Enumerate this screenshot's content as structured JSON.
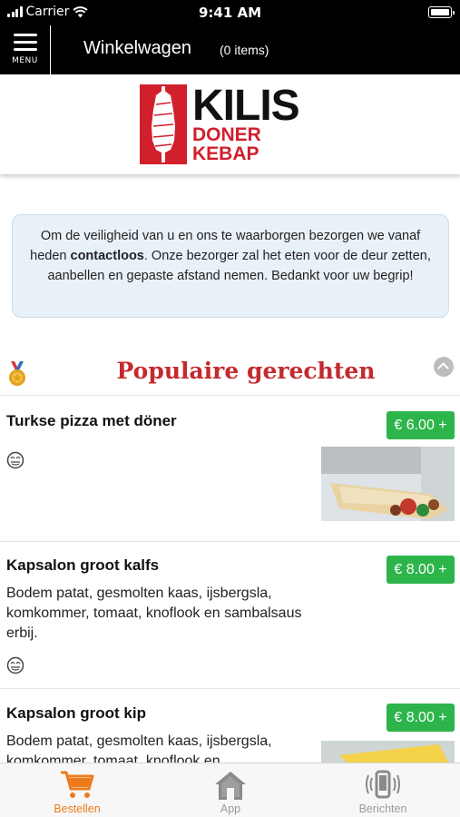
{
  "status_bar": {
    "carrier": "Carrier",
    "time": "9:41 AM"
  },
  "header": {
    "menu_label": "MENU",
    "title": "Winkelwagen",
    "item_count": "(0 items)"
  },
  "logo": {
    "line1": "KILIS",
    "line2": "DONER",
    "line3": "KEBAP"
  },
  "notice": {
    "text_before": "Om de veiligheid van u en ons te waarborgen bezorgen we vanaf heden ",
    "text_bold": "contactloos",
    "text_after": ". Onze bezorger zal het eten voor de deur zetten, aanbellen en gepaste afstand nemen. Bedankt voor uw begrip!"
  },
  "section": {
    "title": "Populaire gerechten"
  },
  "items": [
    {
      "name": "Turkse pizza met döner",
      "price": "€ 6.00 +",
      "description": ""
    },
    {
      "name": "Kapsalon groot kalfs",
      "price": "€ 8.00 +",
      "description": "Bodem patat, gesmolten kaas, ijsbergsla, komkommer, tomaat, knoflook en sambalsaus erbij."
    },
    {
      "name": "Kapsalon groot kip",
      "price": "€ 8.00 +",
      "description": "Bodem patat, gesmolten kaas, ijsbergsla, komkommer, tomaat, knoflook en"
    }
  ],
  "tabs": [
    {
      "label": "Bestellen",
      "active": true
    },
    {
      "label": "App",
      "active": false
    },
    {
      "label": "Berichten",
      "active": false
    }
  ],
  "colors": {
    "brand_red": "#d21f2c",
    "price_green": "#2db54b",
    "active_tab": "#ee7b1b"
  }
}
